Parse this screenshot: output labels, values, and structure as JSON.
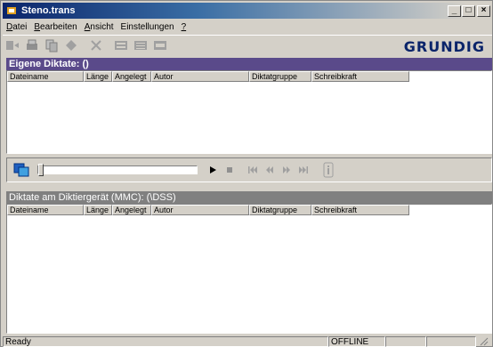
{
  "window": {
    "title": "Steno.trans",
    "min_label": "_",
    "max_label": "□",
    "close_label": "×"
  },
  "menu": {
    "items": [
      {
        "ul": "D",
        "rest": "atei"
      },
      {
        "ul": "B",
        "rest": "earbeiten"
      },
      {
        "ul": "A",
        "rest": "nsicht"
      },
      {
        "ul": "",
        "rest": "Einstellungen"
      },
      {
        "ul": "?",
        "rest": ""
      }
    ]
  },
  "toolbar": {
    "logo": "GRUNDIG"
  },
  "own_dictations": {
    "header": "Eigene Diktate:  ()",
    "columns": [
      "Dateiname",
      "Länge",
      "Angelegt",
      "Autor",
      "Diktatgruppe",
      "Schreibkraft"
    ]
  },
  "player": {
    "position": 0.0
  },
  "device_dictations": {
    "header": "Diktate am Diktiergerät (MMC):  (\\DSS)",
    "columns": [
      "Dateiname",
      "Länge",
      "Angelegt",
      "Autor",
      "Diktatgruppe",
      "Schreibkraft"
    ]
  },
  "status": {
    "text": "Ready",
    "mode": "OFFLINE"
  }
}
